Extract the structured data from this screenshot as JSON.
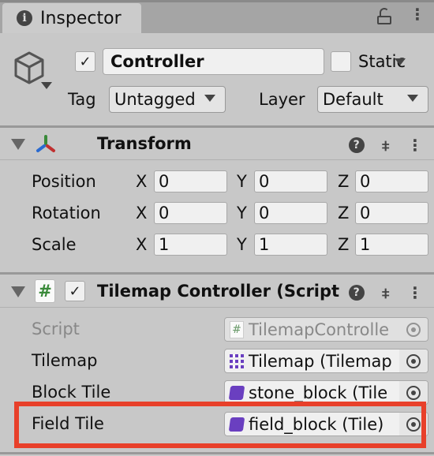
{
  "tab": {
    "title": "Inspector",
    "icon": "info-icon"
  },
  "object": {
    "active": true,
    "name": "Controller",
    "static_label": "Static",
    "static": false,
    "tag_label": "Tag",
    "tag": "Untagged",
    "layer_label": "Layer",
    "layer": "Default"
  },
  "transform": {
    "title": "Transform",
    "rows": [
      {
        "label": "Position",
        "x": "0",
        "y": "0",
        "z": "0"
      },
      {
        "label": "Rotation",
        "x": "0",
        "y": "0",
        "z": "0"
      },
      {
        "label": "Scale",
        "x": "1",
        "y": "1",
        "z": "1"
      }
    ],
    "axes": {
      "x": "X",
      "y": "Y",
      "z": "Z"
    }
  },
  "script_component": {
    "title": "Tilemap Controller (Script",
    "enabled": true,
    "fields": [
      {
        "label": "Script",
        "value": "TilemapControlle",
        "icon": "cs-script-icon",
        "disabled": true
      },
      {
        "label": "Tilemap",
        "value": "Tilemap (Tilemap",
        "icon": "tilemap-grid-icon"
      },
      {
        "label": "Block Tile",
        "value": "stone_block (Tile",
        "icon": "tile-icon"
      },
      {
        "label": "Field Tile",
        "value": "field_block (Tile)",
        "icon": "tile-icon",
        "highlighted": true
      }
    ]
  },
  "colors": {
    "highlight": "#e8402a",
    "tile_icon": "#6a3fc0",
    "script_hash": "#3a8a3a"
  }
}
